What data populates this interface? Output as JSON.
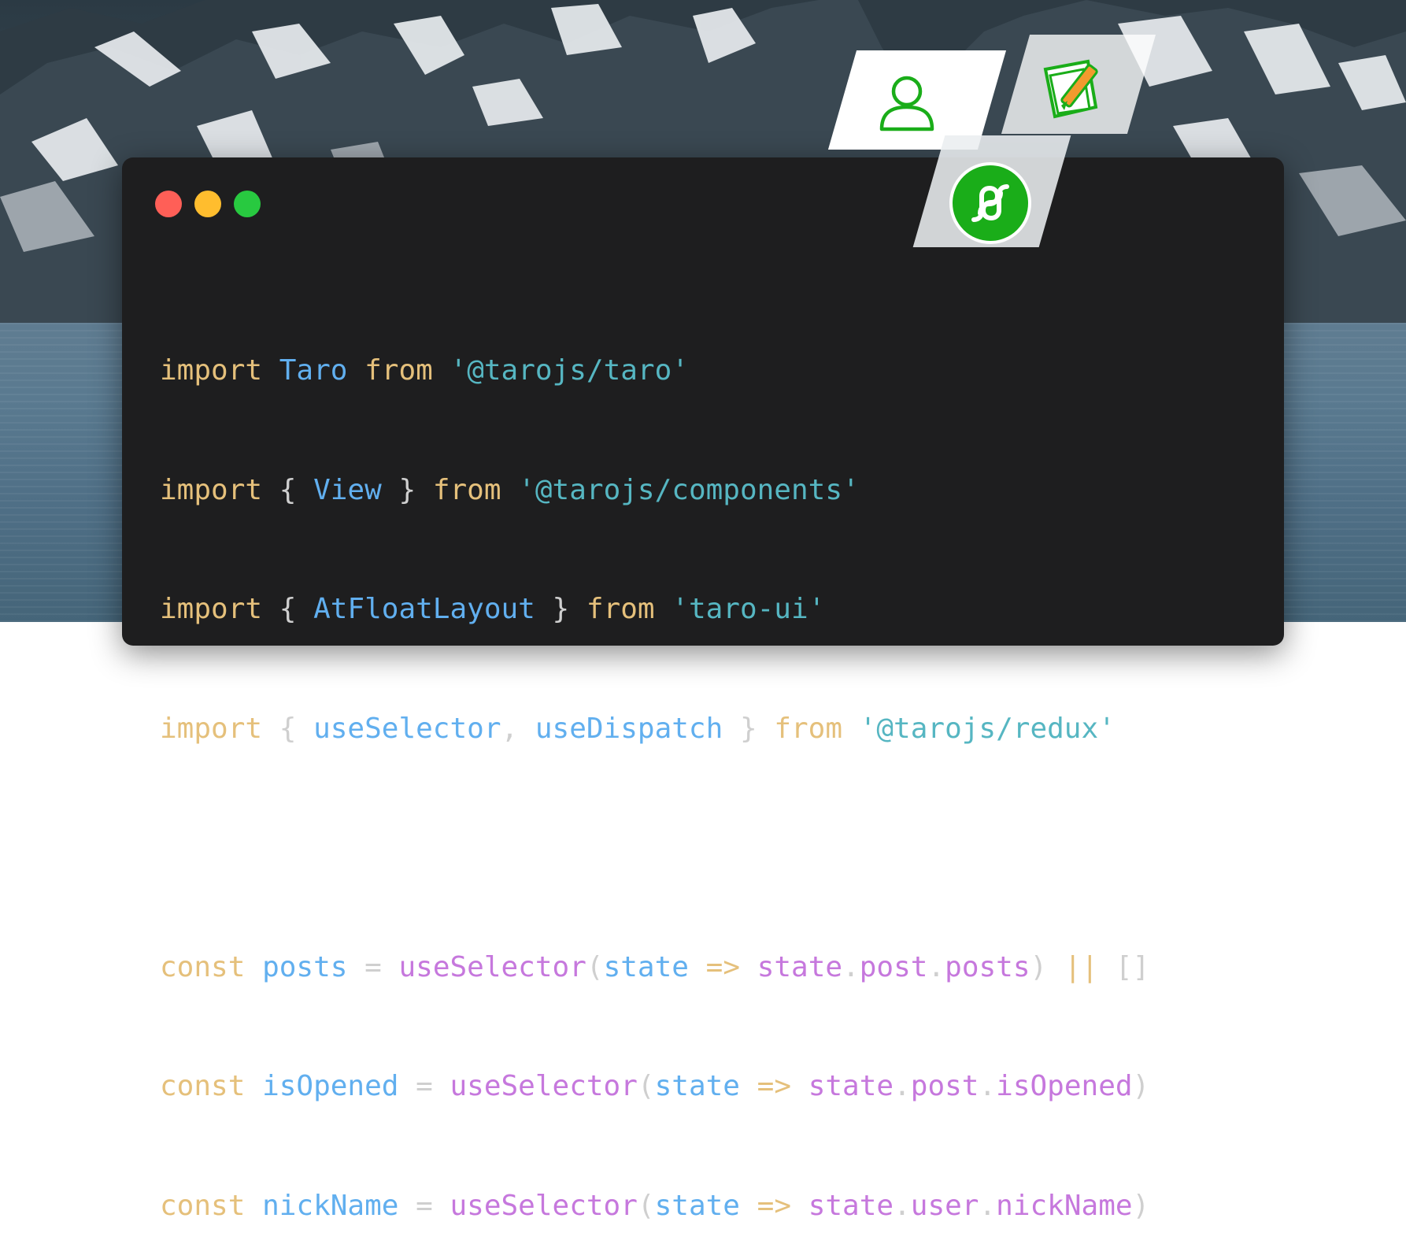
{
  "window": {
    "controls": [
      "close",
      "minimize",
      "maximize"
    ],
    "colors": {
      "close": "#ff5f57",
      "minimize": "#ffbd2e",
      "maximize": "#28c940"
    }
  },
  "code": {
    "lines": [
      {
        "parts": [
          "import",
          " ",
          "Taro",
          " ",
          "from",
          " ",
          "'@tarojs/taro'"
        ]
      },
      {
        "parts": [
          "import",
          " { ",
          "View",
          " } ",
          "from",
          " ",
          "'@tarojs/components'"
        ]
      },
      {
        "parts": [
          "import",
          " { ",
          "AtFloatLayout",
          " } ",
          "from",
          " ",
          "'taro-ui'"
        ]
      },
      {
        "parts": [
          "import",
          " { ",
          "useSelector",
          ", ",
          "useDispatch",
          " } ",
          "from",
          " ",
          "'@tarojs/redux'"
        ]
      },
      {
        "parts": [
          "const",
          " ",
          "posts",
          " = ",
          "useSelector",
          "(",
          "state",
          " ",
          "=>",
          " ",
          "state",
          ".",
          "post",
          ".",
          "posts",
          ") ",
          "||",
          " []"
        ]
      },
      {
        "parts": [
          "const",
          " ",
          "isOpened",
          " = ",
          "useSelector",
          "(",
          "state",
          " ",
          "=>",
          " ",
          "state",
          ".",
          "post",
          ".",
          "isOpened",
          ")"
        ]
      },
      {
        "parts": [
          "const",
          " ",
          "nickName",
          " = ",
          "useSelector",
          "(",
          "state",
          " ",
          "=>",
          " ",
          "state",
          ".",
          "user",
          ".",
          "nickName",
          ")"
        ]
      }
    ]
  },
  "icons": {
    "user": "user-icon",
    "note": "note-edit-icon",
    "link": "miniprogram-icon"
  },
  "accent": "#1aad19"
}
